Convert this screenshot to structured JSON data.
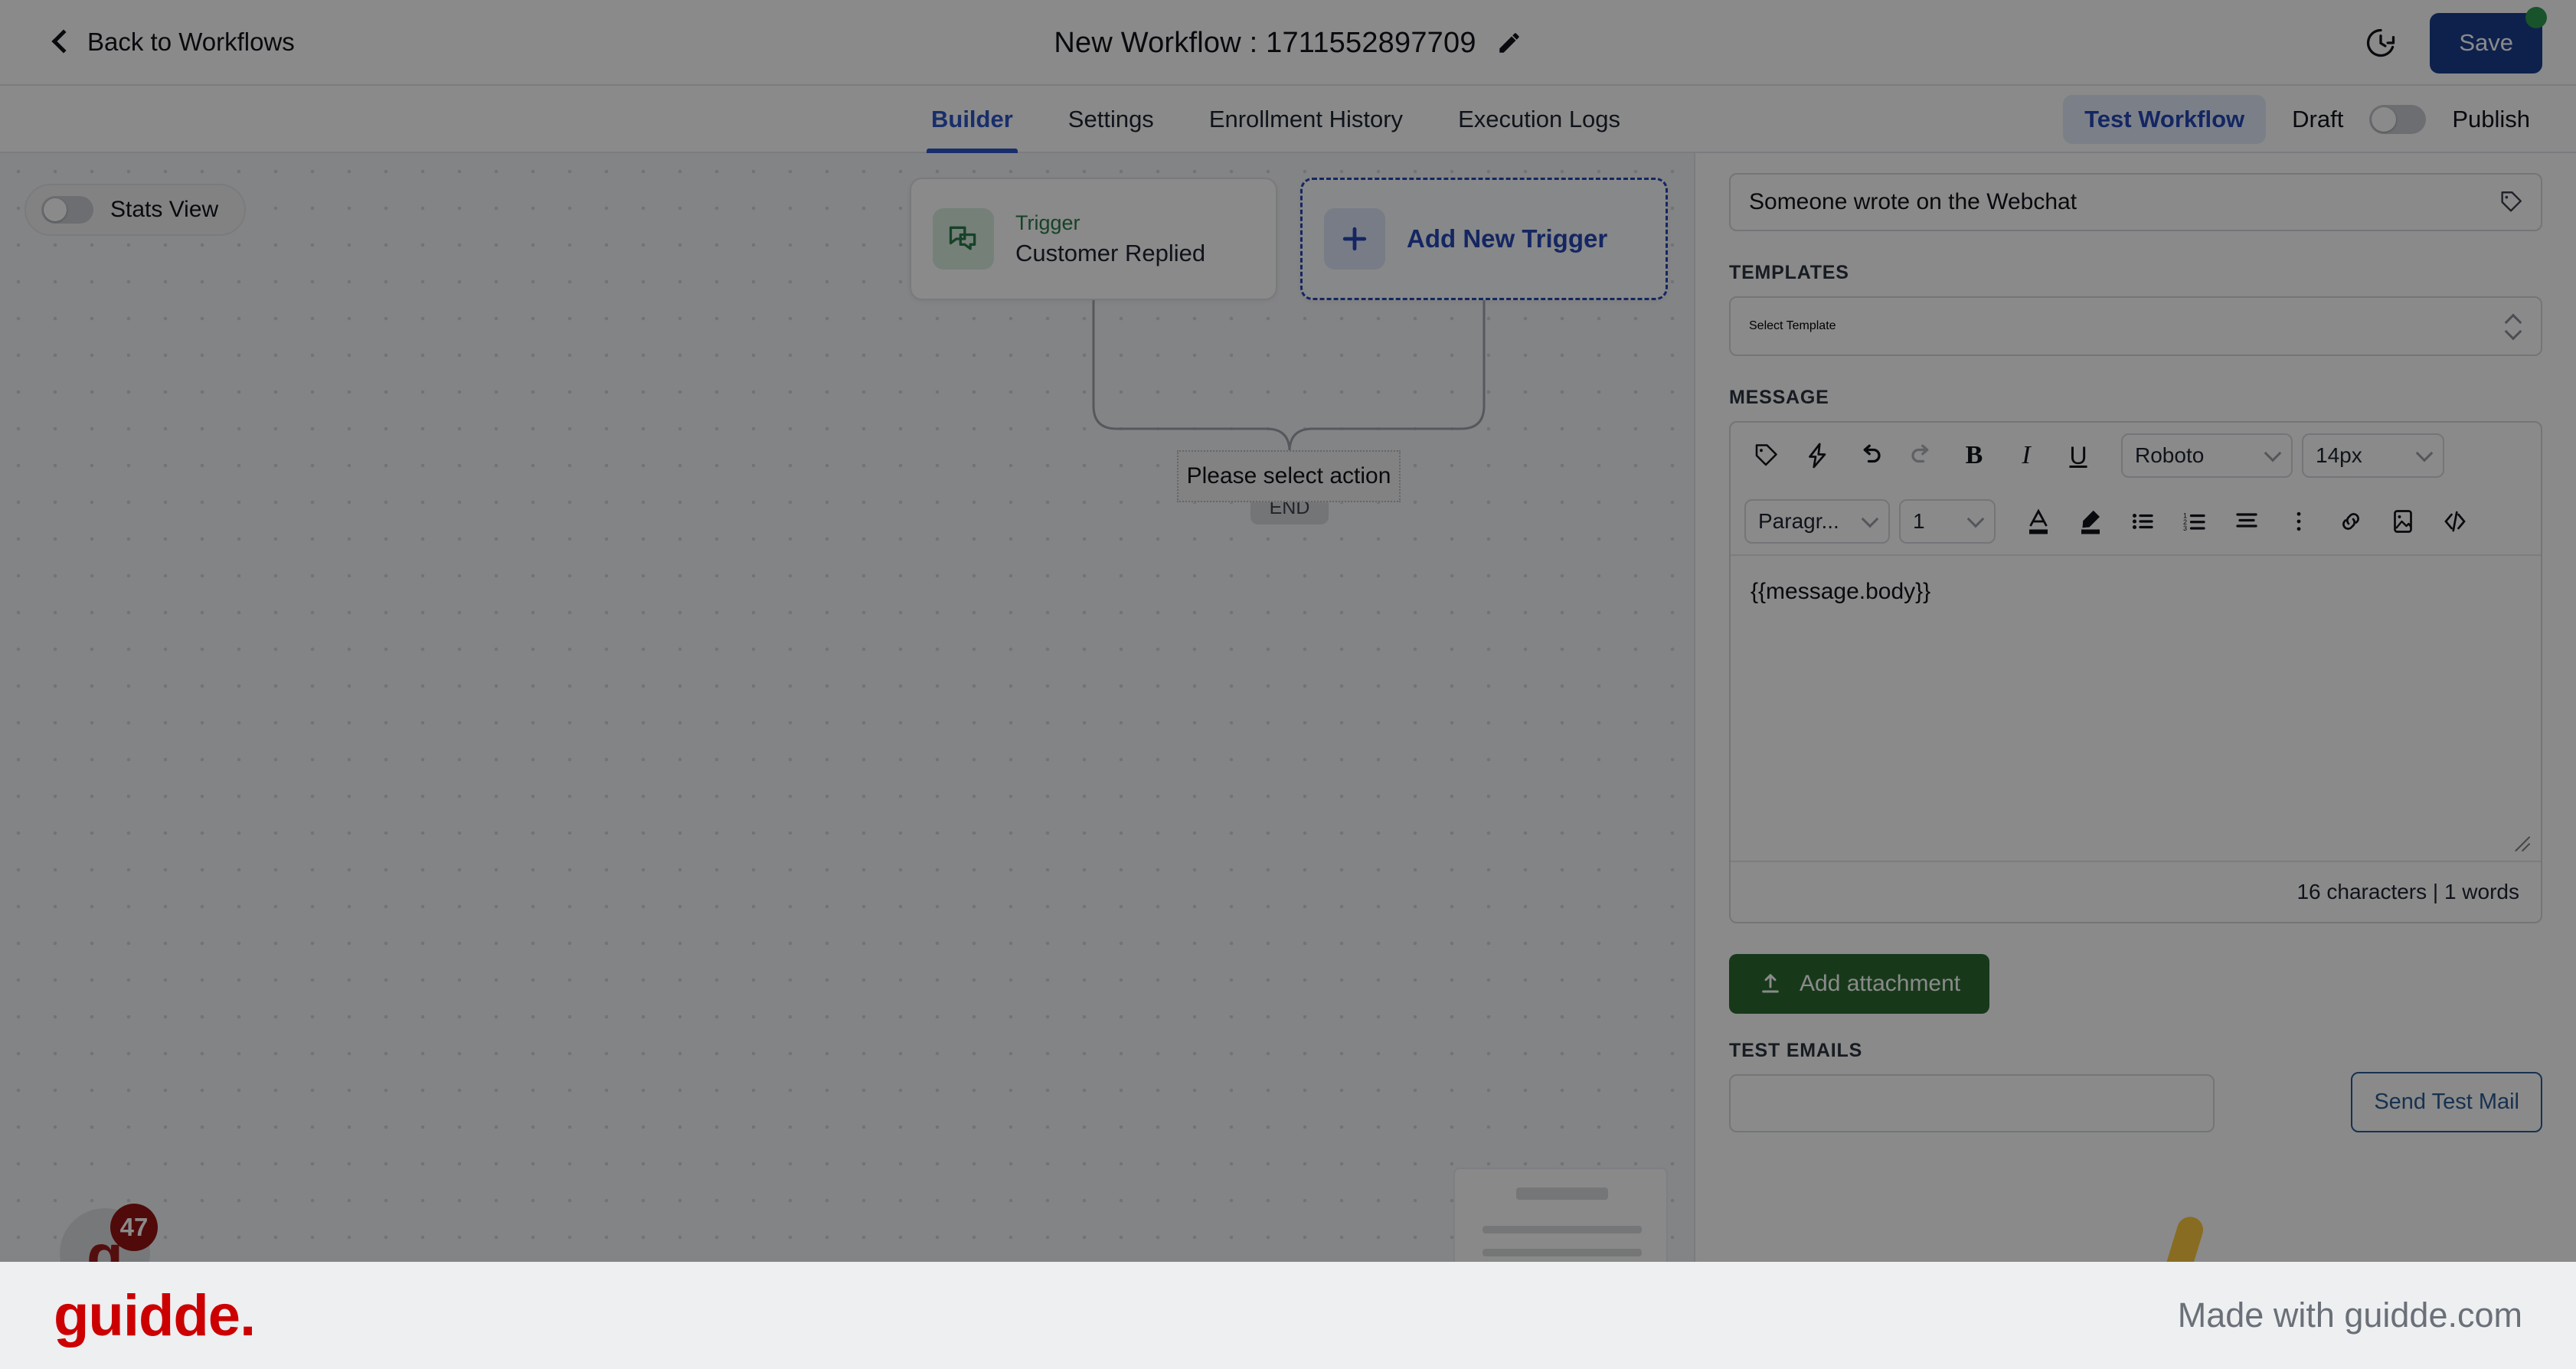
{
  "topbar": {
    "back_label": "Back to Workflows",
    "back_icon": "chevron-left-icon",
    "title": "New Workflow : 1711552897709",
    "edit_icon": "pencil-icon",
    "history_icon": "history-clock-icon",
    "save_label": "Save",
    "save_badge_color": "#2e9950"
  },
  "tabs": {
    "items": [
      {
        "label": "Builder",
        "active": true
      },
      {
        "label": "Settings",
        "active": false
      },
      {
        "label": "Enrollment History",
        "active": false
      },
      {
        "label": "Execution Logs",
        "active": false
      }
    ],
    "test_workflow_label": "Test Workflow",
    "draft_label": "Draft",
    "publish_label": "Publish",
    "publish_toggle_state": "off"
  },
  "canvas": {
    "stats_view_label": "Stats View",
    "stats_view_toggle_state": "off",
    "trigger_node": {
      "icon": "chat-bubbles-icon",
      "kind": "Trigger",
      "name": "Customer Replied"
    },
    "add_trigger_node": {
      "icon": "plus-icon",
      "label": "Add New Trigger"
    },
    "tooltip_text": "Please select action",
    "end_label": "END",
    "widget_badge_count": "47",
    "widget_letter": "g"
  },
  "panel": {
    "trigger_name_value": "Someone wrote on the Webchat",
    "trigger_name_icon": "tag-icon",
    "templates_label": "TEMPLATES",
    "template_placeholder": "Select Template",
    "message_label": "MESSAGE",
    "toolbar_row1": [
      {
        "name": "tag-icon",
        "glyph": "tag"
      },
      {
        "name": "lightning-bolt-icon",
        "glyph": "bolt"
      },
      {
        "name": "undo-icon",
        "glyph": "undo"
      },
      {
        "name": "redo-icon",
        "glyph": "redo"
      },
      {
        "name": "bold-icon",
        "glyph": "B"
      },
      {
        "name": "italic-icon",
        "glyph": "I"
      },
      {
        "name": "underline-icon",
        "glyph": "U"
      }
    ],
    "font_family_value": "Roboto",
    "font_size_value": "14px",
    "block_format_value": "Paragr...",
    "line_height_value": "1",
    "toolbar_row2": [
      {
        "name": "font-color-icon",
        "glyph": "A"
      },
      {
        "name": "highlight-icon",
        "glyph": "pen"
      },
      {
        "name": "bullet-list-icon",
        "glyph": "ul"
      },
      {
        "name": "numbered-list-icon",
        "glyph": "ol"
      },
      {
        "name": "align-icon",
        "glyph": "align"
      },
      {
        "name": "more-options-icon",
        "glyph": "dots"
      },
      {
        "name": "link-icon",
        "glyph": "link"
      },
      {
        "name": "image-icon",
        "glyph": "image"
      },
      {
        "name": "code-icon",
        "glyph": "code"
      }
    ],
    "message_body": "{{message.body}}",
    "counter_text": "16 characters | 1 words",
    "add_attachment_label": "Add attachment",
    "add_attachment_icon": "upload-icon",
    "test_emails_label": "TEST EMAILS",
    "test_emails_value": "",
    "send_test_mail_label": "Send Test Mail"
  },
  "footer": {
    "logo_text": "guidde.",
    "made_with": "Made with guidde.com",
    "logo_color": "#cc0000"
  }
}
